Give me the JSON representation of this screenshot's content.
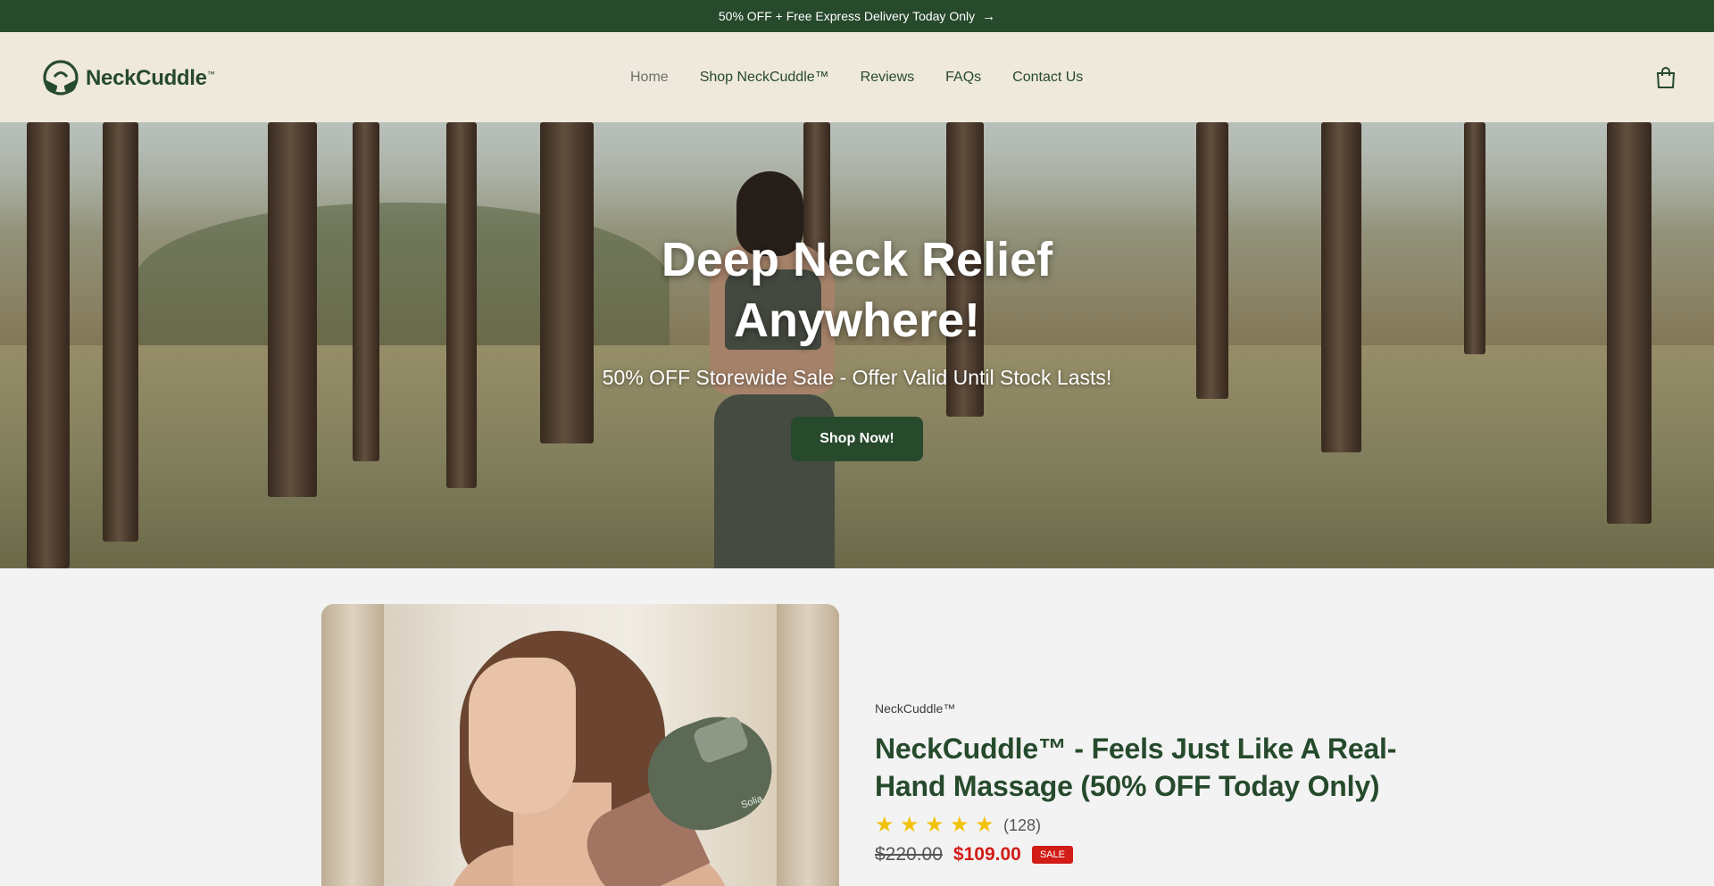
{
  "announcement": {
    "text": "50% OFF + Free Express Delivery Today Only",
    "arrow": "→"
  },
  "header": {
    "brand": "NeckCuddle",
    "trademark": "™",
    "nav": [
      {
        "label": "Home",
        "active": true
      },
      {
        "label": "Shop NeckCuddle™",
        "active": false
      },
      {
        "label": "Reviews",
        "active": false
      },
      {
        "label": "FAQs",
        "active": false
      },
      {
        "label": "Contact Us",
        "active": false
      }
    ],
    "cart_icon": "shopping-bag-icon"
  },
  "hero": {
    "title_line1": "Deep Neck Relief",
    "title_line2": "Anywhere!",
    "subtitle": "50% OFF Storewide Sale - Offer Valid Until Stock Lasts!",
    "cta_label": "Shop Now!"
  },
  "product": {
    "vendor": "NeckCuddle™",
    "title": "NeckCuddle™ - Feels Just Like A Real-Hand Massage (50% OFF Today Only)",
    "rating_stars": 5,
    "review_count": "(128)",
    "compare_price": "$220.00",
    "price": "$109.00",
    "badge": "SALE",
    "device_mark": "Solia"
  },
  "colors": {
    "brand_green": "#27492c",
    "header_bg": "#efe8dc",
    "page_bg": "#f3f3f3",
    "sale_red": "#d11c17",
    "star_yellow": "#f2c20a"
  }
}
